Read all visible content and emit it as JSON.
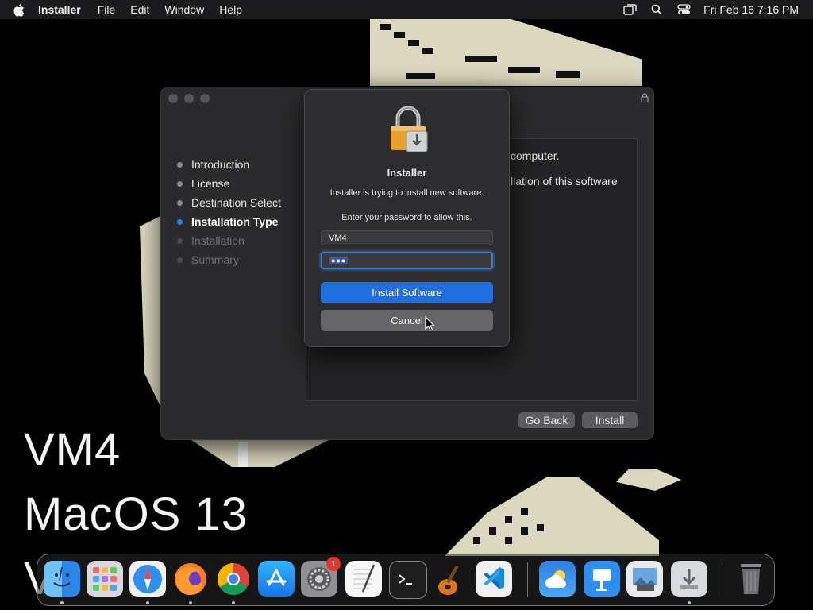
{
  "menubar": {
    "apple_icon": "apple-icon",
    "app_name": "Installer",
    "menus": [
      "File",
      "Edit",
      "Window",
      "Help"
    ],
    "status_icons": [
      "screen-mirroring-icon",
      "search-icon",
      "control-center-icon"
    ],
    "clock": "Fri Feb 16  7:16 PM"
  },
  "wallpaper": {
    "line1": "VM4",
    "line2": "MacOS 13",
    "line3_partial": "V"
  },
  "installer": {
    "steps": [
      {
        "label": "Introduction",
        "state": "done"
      },
      {
        "label": "License",
        "state": "done"
      },
      {
        "label": "Destination Select",
        "state": "done"
      },
      {
        "label": "Installation Type",
        "state": "active"
      },
      {
        "label": "Installation",
        "state": "pending"
      },
      {
        "label": "Summary",
        "state": "pending"
      }
    ],
    "content_line1": "computer.",
    "content_line2": "llation of this software",
    "go_back_label": "Go Back",
    "install_label": "Install"
  },
  "dialog": {
    "icon": "lock-installer-icon",
    "title": "Installer",
    "message": "Installer is trying to install new software.",
    "prompt": "Enter your password to allow this.",
    "username_value": "VM4",
    "password_mask": "●●●",
    "install_software_label": "Install Software",
    "cancel_label": "Cancel"
  },
  "dock": {
    "apps": [
      {
        "name": "Finder",
        "icon": "finder-icon",
        "running": true
      },
      {
        "name": "Launchpad",
        "icon": "launchpad-icon",
        "running": false
      },
      {
        "name": "Safari",
        "icon": "safari-icon",
        "running": true
      },
      {
        "name": "Firefox",
        "icon": "firefox-icon",
        "running": true
      },
      {
        "name": "Chrome",
        "icon": "chrome-icon",
        "running": true
      },
      {
        "name": "App Store",
        "icon": "app-store-icon",
        "running": false
      },
      {
        "name": "System Settings",
        "icon": "system-settings-icon",
        "running": false,
        "badge": "1"
      },
      {
        "name": "TextEdit",
        "icon": "textedit-icon",
        "running": false
      },
      {
        "name": "Terminal",
        "icon": "terminal-icon",
        "running": false
      },
      {
        "name": "GarageBand",
        "icon": "garageband-icon",
        "running": false
      },
      {
        "name": "VS Code",
        "icon": "vscode-icon",
        "running": false
      },
      {
        "name": "Weather",
        "icon": "weather-icon",
        "running": false
      },
      {
        "name": "Keynote",
        "icon": "keynote-icon",
        "running": false
      },
      {
        "name": "Preview",
        "icon": "preview-icon",
        "running": false
      },
      {
        "name": "Installer",
        "icon": "installer-icon",
        "running": true
      },
      {
        "name": "Trash",
        "icon": "trash-icon",
        "running": false
      }
    ]
  }
}
